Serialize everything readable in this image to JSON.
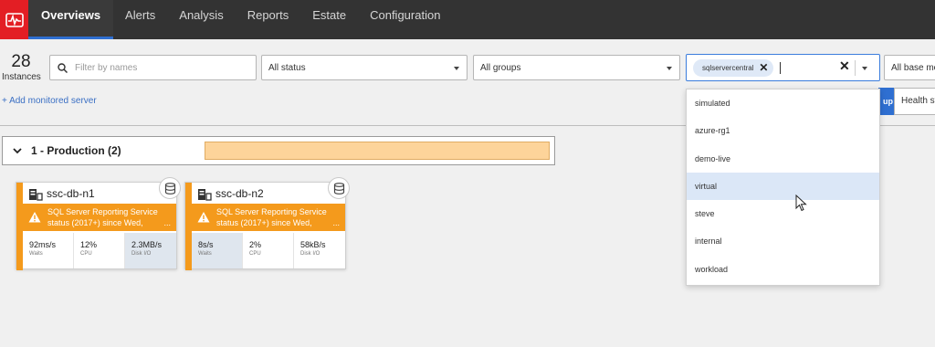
{
  "nav": {
    "items": [
      {
        "label": "Overviews",
        "active": true
      },
      {
        "label": "Alerts"
      },
      {
        "label": "Analysis"
      },
      {
        "label": "Reports"
      },
      {
        "label": "Estate"
      },
      {
        "label": "Configuration"
      }
    ]
  },
  "toolbar": {
    "instance_count": "28",
    "instance_label": "Instances",
    "search_placeholder": "Filter by names",
    "status_select": "All status",
    "groups_select": "All groups",
    "tag_chip": "sqlservercentral",
    "base_select": "All base mo",
    "add_server_link": "+ Add monitored server",
    "group_button": "up",
    "health_button": "Health st"
  },
  "group": {
    "title": "1 - Production (2)"
  },
  "cards": [
    {
      "name": "ssc-db-n1",
      "alert": "SQL Server Reporting Service status (2017+) since Wed,",
      "more": "...",
      "stats": [
        {
          "value": "92ms/s",
          "label": "Waits"
        },
        {
          "value": "12%",
          "label": "CPU"
        },
        {
          "value": "2.3MB/s",
          "label": "Disk I/O"
        }
      ]
    },
    {
      "name": "ssc-db-n2",
      "alert": "SQL Server Reporting Service status (2017+) since Wed,",
      "more": "...",
      "stats": [
        {
          "value": "8s/s",
          "label": "Waits"
        },
        {
          "value": "2%",
          "label": "CPU"
        },
        {
          "value": "58kB/s",
          "label": "Disk I/O"
        }
      ]
    }
  ],
  "dropdown": {
    "options": [
      "simulated",
      "azure-rg1",
      "demo-live",
      "virtual",
      "steve",
      "internal",
      "workload"
    ],
    "hovered": "virtual"
  },
  "colors": {
    "brand_red": "#e31e24",
    "nav_bg": "#333333",
    "accent_blue": "#2f6fd1",
    "warning_orange": "#f49a1c",
    "group_bar": "#fdd49a"
  }
}
